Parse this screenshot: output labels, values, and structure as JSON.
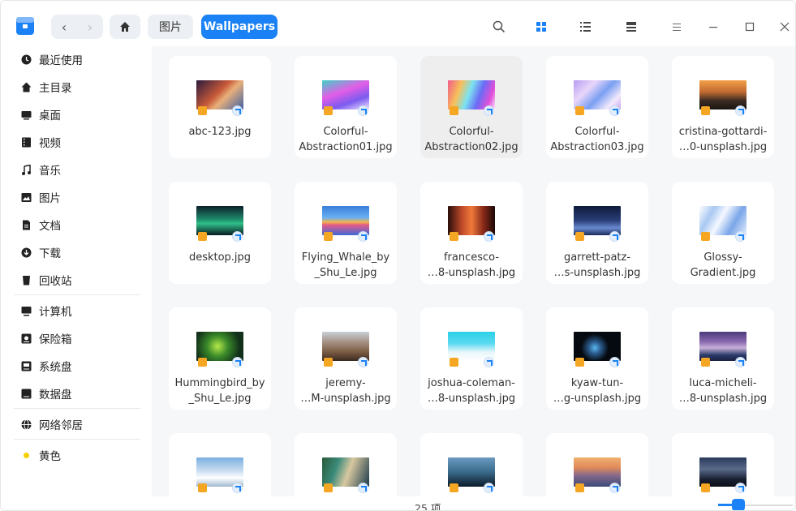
{
  "breadcrumb": [
    "图片",
    "Wallpapers"
  ],
  "sidebar": {
    "items": [
      {
        "label": "最近使用",
        "icon": "clock-icon"
      },
      {
        "label": "主目录",
        "icon": "home-icon"
      },
      {
        "label": "桌面",
        "icon": "desktop-icon"
      },
      {
        "label": "视频",
        "icon": "video-icon"
      },
      {
        "label": "音乐",
        "icon": "music-icon"
      },
      {
        "label": "图片",
        "icon": "picture-icon"
      },
      {
        "label": "文档",
        "icon": "document-icon"
      },
      {
        "label": "下载",
        "icon": "download-icon"
      },
      {
        "label": "回收站",
        "icon": "trash-icon"
      },
      {
        "label": "计算机",
        "icon": "computer-icon"
      },
      {
        "label": "保险箱",
        "icon": "vault-icon"
      },
      {
        "label": "系统盘",
        "icon": "system-disk-icon"
      },
      {
        "label": "数据盘",
        "icon": "data-disk-icon"
      },
      {
        "label": "网络邻居",
        "icon": "network-icon"
      },
      {
        "label": "黄色",
        "icon": "yellow-tag-icon",
        "color": "#f5d000"
      }
    ]
  },
  "files": [
    {
      "name": "abc-123.jpg"
    },
    {
      "name": "Colorful-\nAbstraction01.jpg"
    },
    {
      "name": "Colorful-\nAbstraction02.jpg"
    },
    {
      "name": "Colorful-\nAbstraction03.jpg"
    },
    {
      "name": "cristina-gottardi-\n…0-unsplash.jpg"
    },
    {
      "name": "desktop.jpg"
    },
    {
      "name": "Flying_Whale_by\n_Shu_Le.jpg"
    },
    {
      "name": "francesco-\n…8-unsplash.jpg"
    },
    {
      "name": "garrett-patz-\n…s-unsplash.jpg"
    },
    {
      "name": "Glossy-\nGradient.jpg"
    },
    {
      "name": "Hummingbird_by\n_Shu_Le.jpg"
    },
    {
      "name": "jeremy-\n…M-unsplash.jpg"
    },
    {
      "name": "joshua-coleman-\n…8-unsplash.jpg"
    },
    {
      "name": "kyaw-tun-\n…g-unsplash.jpg"
    },
    {
      "name": "luca-micheli-\n…8-unsplash.jpg"
    },
    {
      "name": ""
    },
    {
      "name": ""
    },
    {
      "name": ""
    },
    {
      "name": ""
    },
    {
      "name": ""
    }
  ],
  "status": {
    "count": "25 项"
  },
  "colors": {
    "accent": "#1b82f5",
    "lock_badge": "#f5a623"
  }
}
